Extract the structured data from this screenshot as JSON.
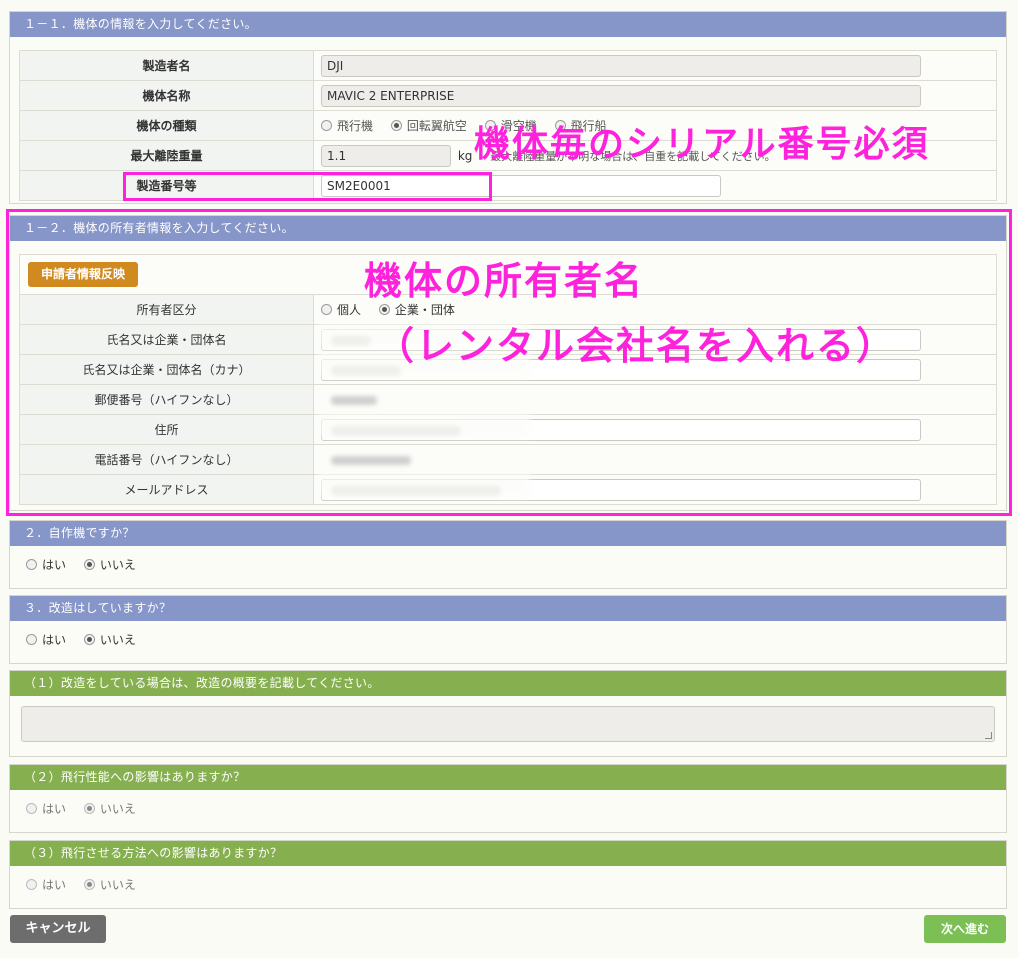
{
  "section1": {
    "title": "１－１．機体の情報を入力してください。",
    "manufacturer_label": "製造者名",
    "manufacturer_value": "DJI",
    "model_label": "機体名称",
    "model_value": "MAVIC 2 ENTERPRISE",
    "type_label": "機体の種類",
    "type_opt1": "飛行機",
    "type_opt2": "回転翼航空",
    "type_opt3": "滑空機",
    "type_opt4": "飛行船",
    "weight_label": "最大離陸重量",
    "weight_value": "1.1",
    "weight_unit": "kg",
    "weight_note": "最大離陸重量が不明な場合は、自重を記載してください。",
    "serial_label": "製造番号等",
    "serial_value": "SM2E0001"
  },
  "section2": {
    "title": "１－２．機体の所有者情報を入力してください。",
    "reflect_button": "申請者情報反映",
    "owner_type_label": "所有者区分",
    "owner_opt1": "個人",
    "owner_opt2": "企業・団体",
    "name_label": "氏名又は企業・団体名",
    "name_kana_label": "氏名又は企業・団体名（カナ）",
    "postal_label": "郵便番号（ハイフンなし）",
    "address_label": "住所",
    "phone_label": "電話番号（ハイフンなし）",
    "email_label": "メールアドレス"
  },
  "q2": {
    "title": "２．自作機ですか？",
    "yes": "はい",
    "no": "いいえ"
  },
  "q3": {
    "title": "３．改造はしていますか？",
    "yes": "はい",
    "no": "いいえ"
  },
  "q3_1": {
    "title": "（１）改造をしている場合は、改造の概要を記載してください。"
  },
  "q3_2": {
    "title": "（２）飛行性能への影響はありますか？",
    "yes": "はい",
    "no": "いいえ"
  },
  "q3_3": {
    "title": "（３）飛行させる方法への影響はありますか？",
    "yes": "はい",
    "no": "いいえ"
  },
  "buttons": {
    "cancel": "キャンセル",
    "next": "次へ進む"
  },
  "annotations": {
    "serial_note": "機体毎のシリアル番号必須",
    "owner_note_1": "機体の所有者名",
    "owner_note_2": "（レンタル会社名を入れる）"
  },
  "colors": {
    "header_blue": "#8796c9",
    "header_green": "#86b04f",
    "annotation_magenta": "#ff22dd",
    "button_orange": "#d18a1f",
    "button_green": "#7cbf54",
    "button_gray": "#6d6d6d"
  }
}
